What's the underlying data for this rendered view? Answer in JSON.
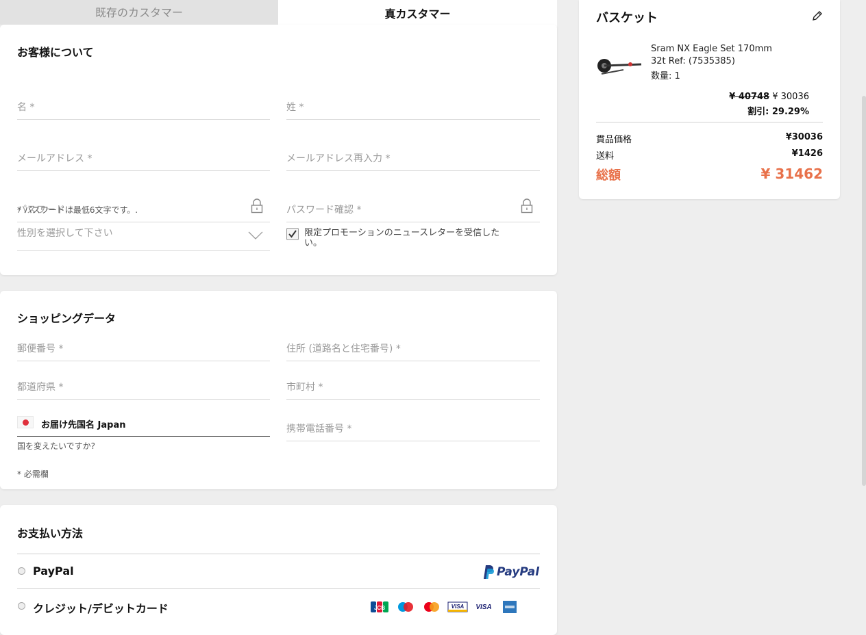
{
  "tabs": {
    "existing_customer": "既存のカスタマー",
    "new_customer": "真カスタマー"
  },
  "about": {
    "title": "お客様について",
    "first_name": "名 *",
    "last_name": "姓 *",
    "email": "メールアドレス *",
    "email_confirm": "メールアドレス再入力 *",
    "password": "パスワード *",
    "password_confirm": "パスワード確認 *",
    "password_hint": "* パスワードは最低6文字です。.",
    "gender": "性別を選択して下さい",
    "newsletter_label": "限定プロモーションのニュースレターを受信したい。",
    "newsletter_checked": true
  },
  "shopping": {
    "title": "ショッピングデータ",
    "postal_code": "郵便番号 *",
    "address": "住所 (道路名と住宅番号) *",
    "prefecture": "都道府県 *",
    "city": "市町村 *",
    "country_label": "お届け先国名 Japan",
    "mobile": "携帯電話番号 *",
    "change_country": "国を変えたいですか?",
    "required_note": "* 必需欄"
  },
  "payment": {
    "title": "お支払い方法",
    "paypal_label": "PayPal",
    "paypal_logo_text": "PayPal",
    "card_label": "クレジット/デビットカード",
    "card_icons": [
      "JCB",
      "maestro",
      "mastercard",
      "VISA",
      "VISA Electron",
      "American Express"
    ]
  },
  "basket": {
    "title": "バスケット",
    "product_name": "Sram NX Eagle Set 170mm",
    "product_ref": "32t Ref: (7535385)",
    "product_qty": "数量: 1",
    "old_price": "¥ 40748",
    "new_price": "¥ 30036",
    "discount": "割引: 29.29%",
    "subtotal_label": "貫品価格",
    "subtotal_value": "¥30036",
    "shipping_label": "送料",
    "shipping_value": "¥1426",
    "total_label": "総額",
    "total_value": "¥ 31462"
  },
  "colors": {
    "accent": "#e8714a",
    "paypal_blue": "#253b80",
    "paypal_light": "#179bd7"
  }
}
